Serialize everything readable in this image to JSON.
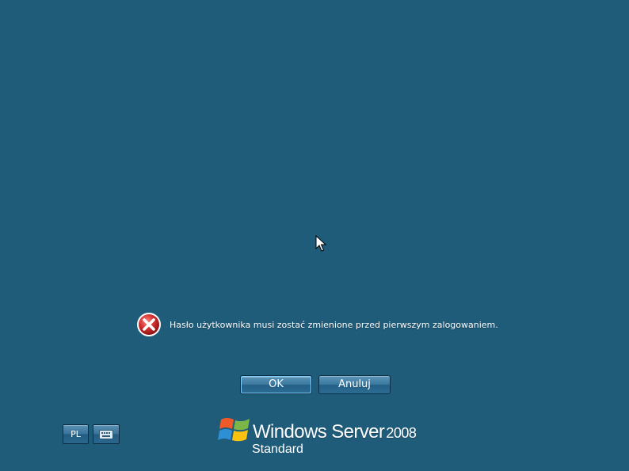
{
  "message": {
    "text": "Hasło użytkownika musi zostać zmienione przed pierwszym zalogowaniem.",
    "icon": "error-icon",
    "icon_color": "#c62828"
  },
  "buttons": {
    "ok_label": "OK",
    "cancel_label": "Anuluj"
  },
  "accessibility": {
    "language_label": "PL",
    "keyboard_icon": "keyboard-icon"
  },
  "brand": {
    "product": "Windows Server",
    "version": "2008",
    "edition": "Standard"
  },
  "colors": {
    "background": "#1f5c7a",
    "button_focus_border": "#7fd0ff"
  }
}
